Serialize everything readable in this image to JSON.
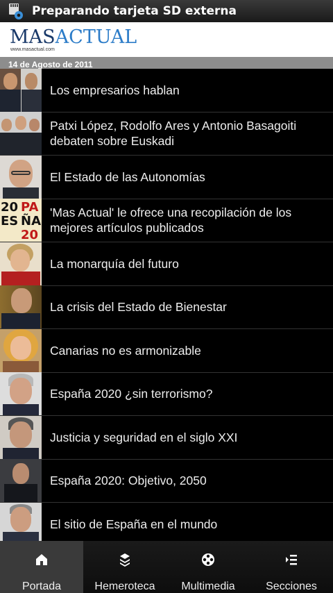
{
  "status_bar": {
    "text": "Preparando tarjeta SD externa",
    "icon": "sd-card-settings-icon"
  },
  "header": {
    "logo_mas": "MAS",
    "logo_actual": "ACTUAL",
    "logo_url": "www.masactual.com"
  },
  "date": "14 de Agosto de 2011",
  "articles": [
    {
      "title": "Los empresarios hablan",
      "thumb": "two-men-photo"
    },
    {
      "title": "Patxi López, Rodolfo Ares y Antonio Basagoiti debaten sobre Euskadi",
      "thumb": "three-men-photo"
    },
    {
      "title": "El Estado de las Autonomías",
      "thumb": "man-glasses-photo"
    },
    {
      "title": "'Mas Actual' le ofrece una recopilación de los mejores artículos publicados",
      "thumb": "espana-2020-logo"
    },
    {
      "title": "La monarquía del futuro",
      "thumb": "woman-photo"
    },
    {
      "title": "La crisis del Estado de Bienestar",
      "thumb": "man-suit-photo"
    },
    {
      "title": "Canarias no es armonizable",
      "thumb": "blonde-woman-photo"
    },
    {
      "title": "España 2020 ¿sin terrorismo?",
      "thumb": "grey-hair-man-photo"
    },
    {
      "title": "Justicia y seguridad en el siglo XXI",
      "thumb": "older-man-photo"
    },
    {
      "title": "España 2020: Objetivo, 2050",
      "thumb": "man-dark-suit-photo"
    },
    {
      "title": "El sitio de España en el mundo",
      "thumb": "man-tie-photo"
    }
  ],
  "nav": [
    {
      "label": "Portada",
      "icon": "home-icon",
      "active": true
    },
    {
      "label": "Hemeroteca",
      "icon": "layers-icon",
      "active": false
    },
    {
      "label": "Multimedia",
      "icon": "film-reel-icon",
      "active": false
    },
    {
      "label": "Secciones",
      "icon": "list-icon",
      "active": false
    }
  ]
}
